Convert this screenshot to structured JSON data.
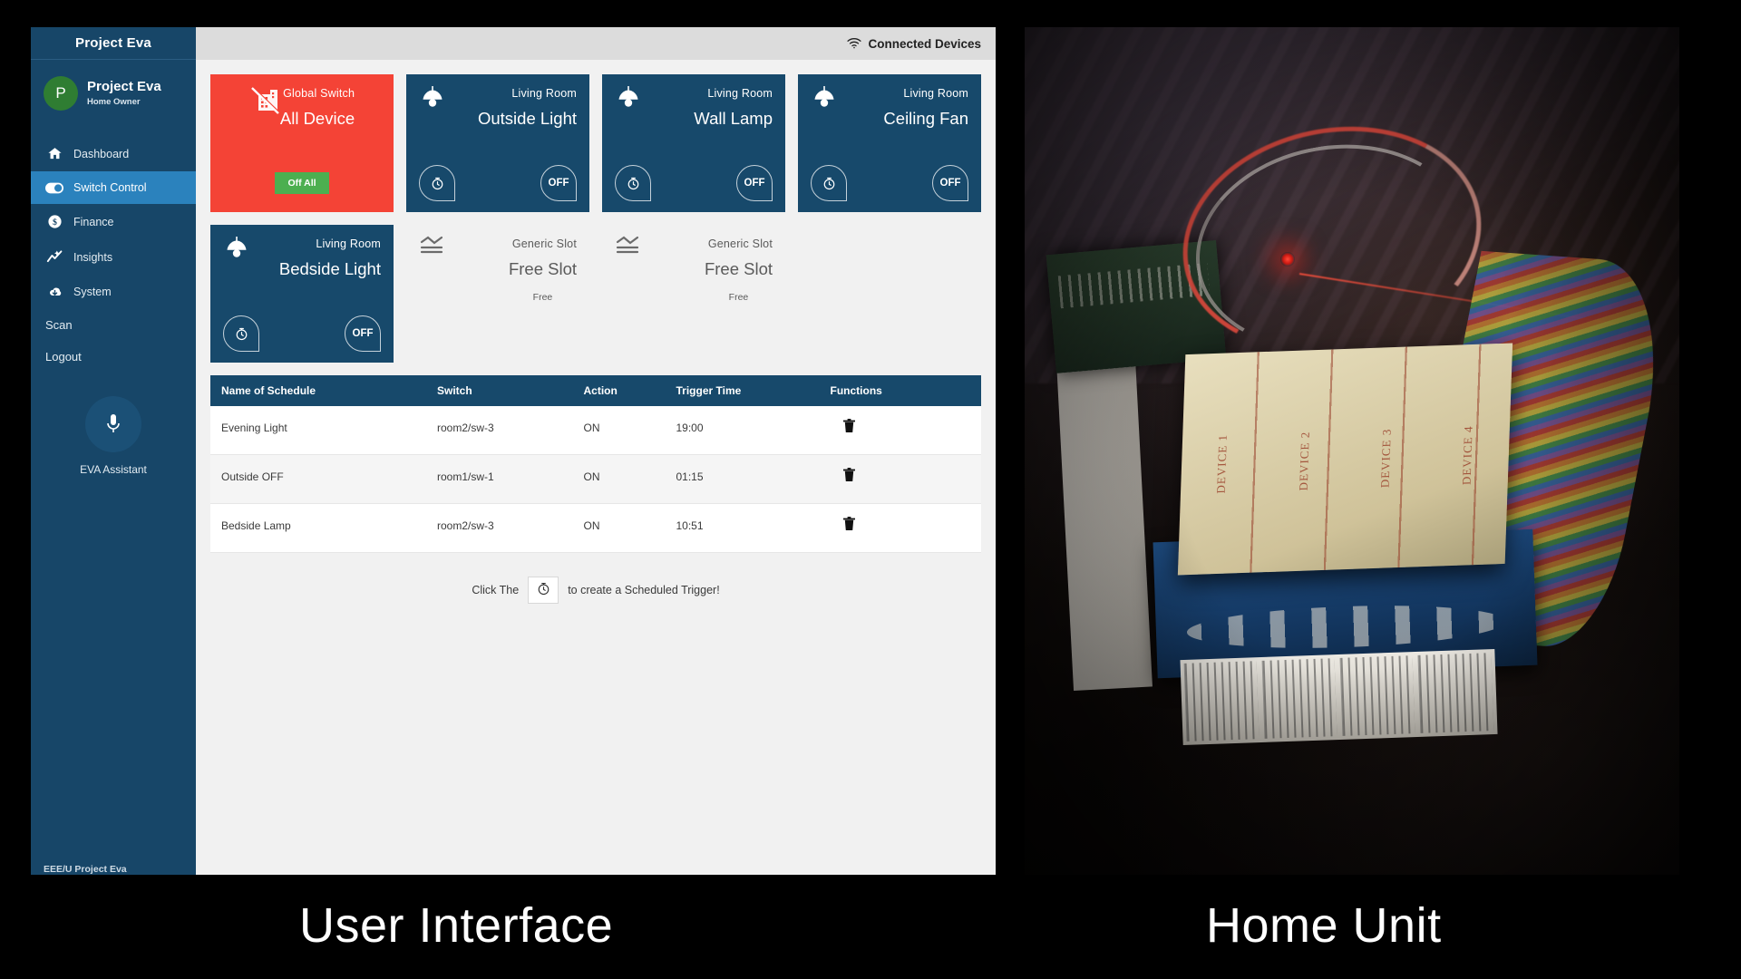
{
  "captions": {
    "left": "User Interface",
    "right": "Home Unit"
  },
  "sidebar": {
    "brand": "Project Eva",
    "profile": {
      "avatar_initial": "P",
      "name": "Project Eva",
      "role": "Home Owner"
    },
    "nav_items": [
      {
        "label": "Dashboard",
        "icon": "home-icon",
        "active": false
      },
      {
        "label": "Switch Control",
        "icon": "toggle-icon",
        "active": true
      },
      {
        "label": "Finance",
        "icon": "dollar-icon",
        "active": false
      },
      {
        "label": "Insights",
        "icon": "chart-icon",
        "active": false
      },
      {
        "label": "System",
        "icon": "cloud-download-icon",
        "active": false
      }
    ],
    "plain_items": [
      {
        "label": "Scan"
      },
      {
        "label": "Logout"
      }
    ],
    "assistant": {
      "icon": "microphone-icon",
      "label": "EVA Assistant"
    },
    "footer": "EEE/U Project Eva",
    "colors": {
      "bg": "#174668",
      "active": "#2b82bd",
      "avatar": "#2f7d32"
    }
  },
  "topbar": {
    "status_icon": "wifi-icon",
    "status_label": "Connected Devices"
  },
  "cards": [
    {
      "kind": "global",
      "icon": "building-slash-icon",
      "room": "Global Switch",
      "title": "All Device",
      "button_label": "Off All",
      "color": "#f44336"
    },
    {
      "kind": "switch",
      "icon": "pendant-lamp-icon",
      "room": "Living Room",
      "title": "Outside Light",
      "timer_icon": "timer-icon",
      "state_label": "OFF",
      "color": "#17496b"
    },
    {
      "kind": "switch",
      "icon": "pendant-lamp-icon",
      "room": "Living Room",
      "title": "Wall Lamp",
      "timer_icon": "timer-icon",
      "state_label": "OFF",
      "color": "#17496b"
    },
    {
      "kind": "switch",
      "icon": "pendant-lamp-icon",
      "room": "Living Room",
      "title": "Ceiling Fan",
      "timer_icon": "timer-icon",
      "state_label": "OFF",
      "color": "#17496b"
    },
    {
      "kind": "switch",
      "icon": "pendant-lamp-icon",
      "room": "Living Room",
      "title": "Bedside Light",
      "timer_icon": "timer-icon",
      "state_label": "OFF",
      "color": "#17496b"
    },
    {
      "kind": "free",
      "icon": "signal-slot-icon",
      "room": "Generic Slot",
      "title": "Free Slot",
      "sub": "Free",
      "color": "#f1f1f1"
    },
    {
      "kind": "free",
      "icon": "signal-slot-icon",
      "room": "Generic Slot",
      "title": "Free Slot",
      "sub": "Free",
      "color": "#f1f1f1"
    }
  ],
  "schedule_table": {
    "headers": [
      "Name of Schedule",
      "Switch",
      "Action",
      "Trigger Time",
      "Functions"
    ],
    "rows": [
      {
        "name": "Evening Light",
        "switch": "room2/sw-3",
        "action": "ON",
        "time": "19:00",
        "fn_icon": "trash-icon"
      },
      {
        "name": "Outside OFF",
        "switch": "room1/sw-1",
        "action": "ON",
        "time": "01:15",
        "fn_icon": "trash-icon"
      },
      {
        "name": "Bedside Lamp",
        "switch": "room2/sw-3",
        "action": "ON",
        "time": "10:51",
        "fn_icon": "trash-icon"
      }
    ]
  },
  "hint": {
    "before": "Click The",
    "icon": "timer-icon",
    "after": "to create a Scheduled Trigger!"
  }
}
